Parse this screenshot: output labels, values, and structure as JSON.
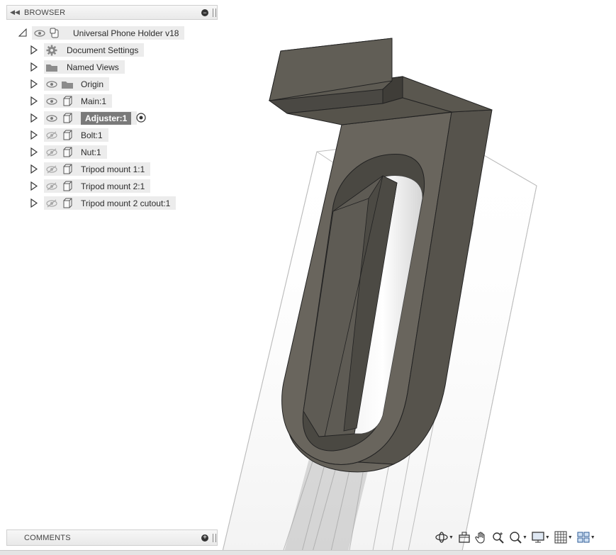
{
  "browser": {
    "title": "BROWSER",
    "root": {
      "label": "Universal Phone Holder v18"
    },
    "items": [
      {
        "label": "Document Settings",
        "icon": "gear-icon",
        "visible": null,
        "type": "settings"
      },
      {
        "label": "Named Views",
        "icon": "folder-icon",
        "visible": null,
        "type": "folder"
      },
      {
        "label": "Origin",
        "icon": "folder-icon",
        "visible": true,
        "type": "folder"
      },
      {
        "label": "Main:1",
        "icon": "component-icon",
        "visible": true,
        "type": "component"
      },
      {
        "label": "Adjuster:1",
        "icon": "component-icon",
        "visible": true,
        "type": "component",
        "selected": true,
        "active": true
      },
      {
        "label": "Bolt:1",
        "icon": "component-icon",
        "visible": false,
        "type": "component"
      },
      {
        "label": "Nut:1",
        "icon": "component-icon",
        "visible": false,
        "type": "component"
      },
      {
        "label": "Tripod mount 1:1",
        "icon": "component-icon",
        "visible": false,
        "type": "component"
      },
      {
        "label": "Tripod mount 2:1",
        "icon": "component-icon",
        "visible": false,
        "type": "component"
      },
      {
        "label": "Tripod mount 2 cutout:1",
        "icon": "component-icon",
        "visible": false,
        "type": "component"
      }
    ]
  },
  "comments": {
    "title": "COMMENTS"
  },
  "toolbar": {
    "buttons": [
      {
        "name": "orbit-button",
        "icon": "orbit-icon",
        "dropdown": true
      },
      {
        "name": "look-at-button",
        "icon": "look-at-icon",
        "dropdown": false
      },
      {
        "name": "pan-button",
        "icon": "hand-icon",
        "dropdown": false
      },
      {
        "name": "zoom-button",
        "icon": "zoom-icon",
        "dropdown": false
      },
      {
        "name": "fit-button",
        "icon": "zoom-window-icon",
        "dropdown": true
      },
      {
        "name": "display-settings-button",
        "icon": "display-icon",
        "dropdown": true
      },
      {
        "name": "grid-settings-button",
        "icon": "grid-icon",
        "dropdown": true
      },
      {
        "name": "viewports-button",
        "icon": "viewports-icon",
        "dropdown": true
      }
    ]
  },
  "colors": {
    "model_face": "#66625a",
    "model_top": "#5b5850",
    "model_side": "#403e39",
    "ghost_edge": "#b8b8b8",
    "selection_bg": "#7a7a7a"
  }
}
